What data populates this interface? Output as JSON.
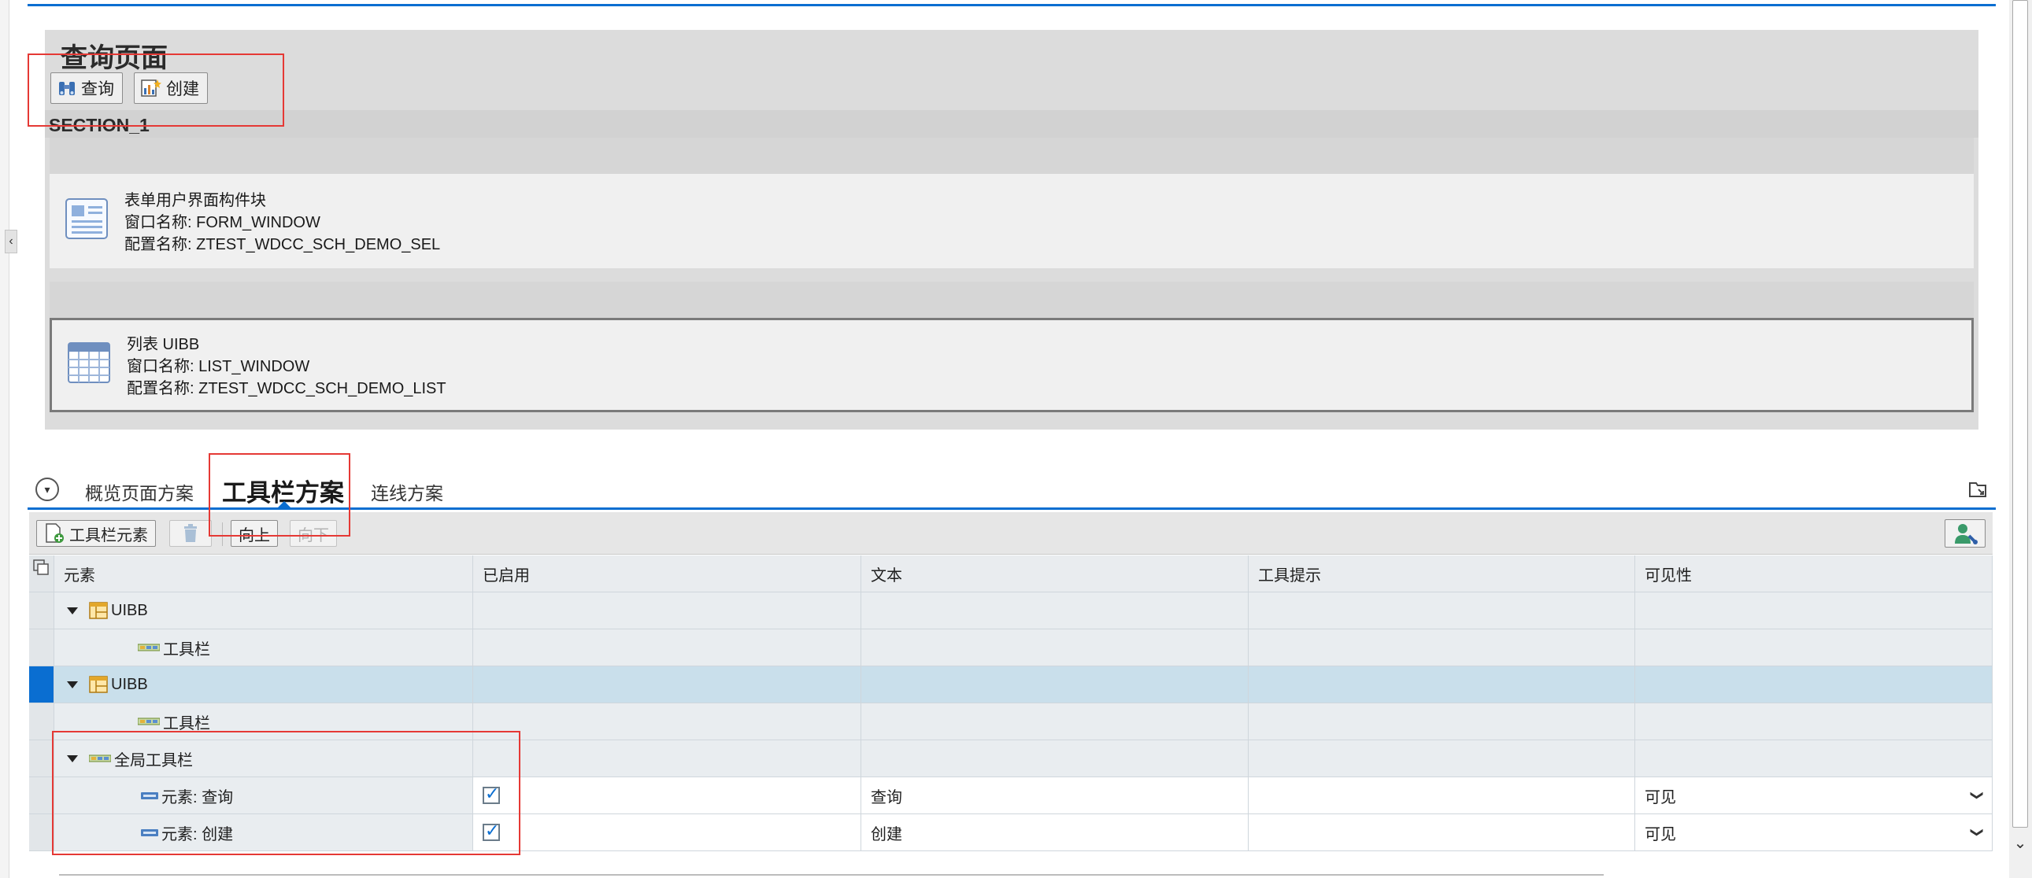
{
  "preview": {
    "title": "查询页面",
    "buttons": [
      {
        "label": "查询",
        "icon": "binoculars-icon"
      },
      {
        "label": "创建",
        "icon": "chart-create-icon"
      }
    ],
    "section_label": "SECTION_1",
    "uibbs": [
      {
        "type": "表单用户界面构件块",
        "window": "窗口名称: FORM_WINDOW",
        "config": "配置名称: ZTEST_WDCC_SCH_DEMO_SEL",
        "icon": "form-icon"
      },
      {
        "type": "列表 UIBB",
        "window": "窗口名称: LIST_WINDOW",
        "config": "配置名称: ZTEST_WDCC_SCH_DEMO_LIST",
        "icon": "list-icon"
      }
    ]
  },
  "tabs": [
    {
      "label": "概览页面方案",
      "active": false
    },
    {
      "label": "工具栏方案",
      "active": true
    },
    {
      "label": "连线方案",
      "active": false
    }
  ],
  "table_toolbar": {
    "add_label": "工具栏元素",
    "up_label": "向上",
    "down_label": "向下"
  },
  "table": {
    "columns": [
      "元素",
      "已启用",
      "文本",
      "工具提示",
      "可见性"
    ],
    "rows": [
      {
        "element": "UIBB",
        "level": 0,
        "kind": "uibb",
        "expanded": true,
        "selected": false
      },
      {
        "element": "工具栏",
        "level": 1,
        "kind": "toolbar",
        "selected": false
      },
      {
        "element": "UIBB",
        "level": 0,
        "kind": "uibb",
        "expanded": true,
        "selected": true
      },
      {
        "element": "工具栏",
        "level": 1,
        "kind": "toolbar",
        "selected": false
      },
      {
        "element": "全局工具栏",
        "level": 0,
        "kind": "toolbar",
        "expanded": true,
        "selected": false
      },
      {
        "element": "元素: 查询",
        "level": 1,
        "kind": "button",
        "enabled": true,
        "text": "查询",
        "tooltip": "",
        "visibility": "可见"
      },
      {
        "element": "元素: 创建",
        "level": 1,
        "kind": "button",
        "enabled": true,
        "text": "创建",
        "tooltip": "",
        "visibility": "可见"
      }
    ]
  },
  "colors": {
    "accent": "#0a6ed1",
    "highlight": "#e53935",
    "selected_row": "#c9dfeb"
  }
}
